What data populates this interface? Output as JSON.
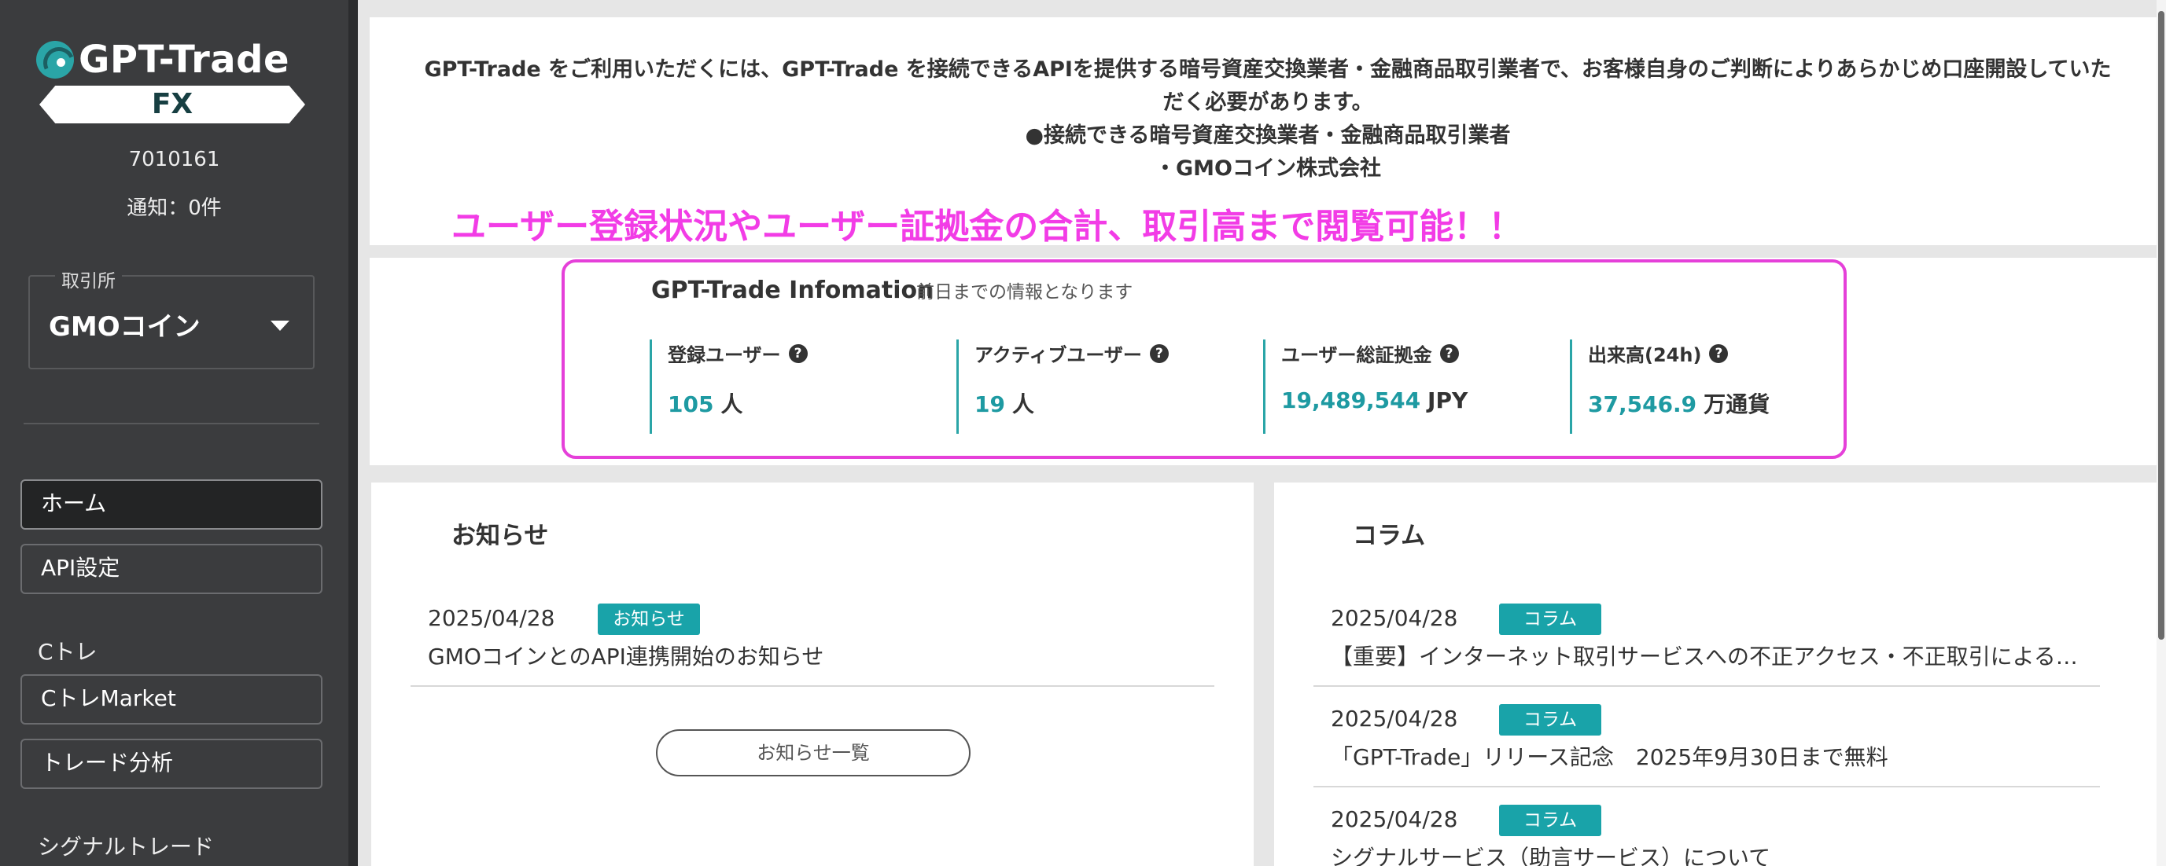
{
  "sidebar": {
    "logo_text": "GPT-Trade",
    "logo_fx": "FX",
    "user_id": "7010161",
    "notice": "通知：0件",
    "exchange": {
      "legend": "取引所",
      "value": "GMOコイン"
    },
    "nav": [
      {
        "label": "ホーム",
        "active": true
      },
      {
        "label": "API設定"
      }
    ],
    "section_ctore": "Cトレ",
    "ctore_items": [
      {
        "label": "CトレMarket"
      },
      {
        "label": "トレード分析"
      }
    ],
    "section_signal": "シグナルトレード"
  },
  "banner": {
    "line1": "GPT-Trade をご利用いただくには、GPT-Trade を接続できるAPIを提供する暗号資産交換業者・金融商品取引業者で、お客様自身のご判断によりあらかじめ口座開設していた",
    "line2": "だく必要があります。",
    "line3": "●接続できる暗号資産交換業者・金融商品取引業者",
    "line4": "・GMOコイン株式会社"
  },
  "promo": "ユーザー登録状況やユーザー証拠金の合計、取引高まで閲覧可能！！",
  "info": {
    "title": "GPT-Trade Infomation",
    "subtitle": "前日までの情報となります",
    "stats": [
      {
        "label": "登録ユーザー",
        "value": "105",
        "unit": "人"
      },
      {
        "label": "アクティブユーザー",
        "value": "19",
        "unit": "人"
      },
      {
        "label": "ユーザー総証拠金",
        "value": "19,489,544",
        "unit": "JPY"
      },
      {
        "label": "出来高(24h)",
        "value": "37,546.9",
        "unit": "万通貨"
      }
    ],
    "help_glyph": "?"
  },
  "news": {
    "title": "お知らせ",
    "items": [
      {
        "date": "2025/04/28",
        "tag": "お知らせ",
        "text": "GMOコインとのAPI連携開始のお知らせ"
      }
    ],
    "more_button": "お知らせ一覧"
  },
  "column": {
    "title": "コラム",
    "items": [
      {
        "date": "2025/04/28",
        "tag": "コラム",
        "text": "【重要】インターネット取引サービスへの不正アクセス・不正取引による被害にご注意ください"
      },
      {
        "date": "2025/04/28",
        "tag": "コラム",
        "text": "「GPT-Trade」リリース記念　2025年9月30日まで無料"
      },
      {
        "date": "2025/04/28",
        "tag": "コラム",
        "text": "シグナルサービス（助言サービス）について"
      }
    ]
  },
  "colors": {
    "sidebar_bg": "#3b3c3e",
    "accent_teal": "#19a3a9",
    "promo_magenta": "#f23ce6"
  }
}
